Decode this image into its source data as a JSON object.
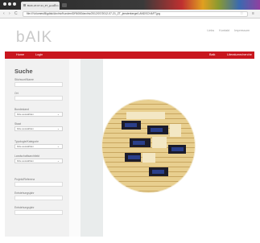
{
  "browser": {
    "tab_title": "BAIK-AT-07-21_ZT_jensterm",
    "tab_close": "×",
    "address": "file:///Volumes/Bigdisk/Archiv/Kunden/DR6000/archiv/2012/07/2012-07-21_ZT_jensterkerge/LANDSCHAFT.jpg",
    "nav_back": "‹",
    "nav_forward": "›",
    "nav_reload": "C",
    "star": "☆",
    "menu": "≡"
  },
  "site": {
    "logo": "bAIK",
    "top_links": [
      "Links",
      "Kontakt",
      "Impressum"
    ],
    "nav": {
      "home": "Home",
      "login": "Login",
      "right_1": "Baik",
      "right_2": "Literaturrecherche"
    }
  },
  "search": {
    "title": "Suche",
    "fields": [
      {
        "label": "Stichwort/Name",
        "type": "input",
        "value": ""
      },
      {
        "label": "Ort",
        "type": "input",
        "value": ""
      },
      {
        "label": "Bundesland",
        "type": "select",
        "value": "bitte auswählen"
      },
      {
        "label": "Staat",
        "type": "select",
        "value": "bitte auswählen"
      },
      {
        "label": "Typologie/Kategorie",
        "type": "select",
        "value": "bitte auswählen"
      },
      {
        "label": "Landschaftsarchitekt",
        "type": "select",
        "value": "bitte auswählen"
      },
      {
        "label": "Projekt/Referenz",
        "type": "input",
        "value": ""
      },
      {
        "label": "Entstehungsjahr",
        "type": "input",
        "value": ""
      },
      {
        "label": "Entstehungsjahr",
        "type": "input",
        "value": ""
      }
    ]
  }
}
